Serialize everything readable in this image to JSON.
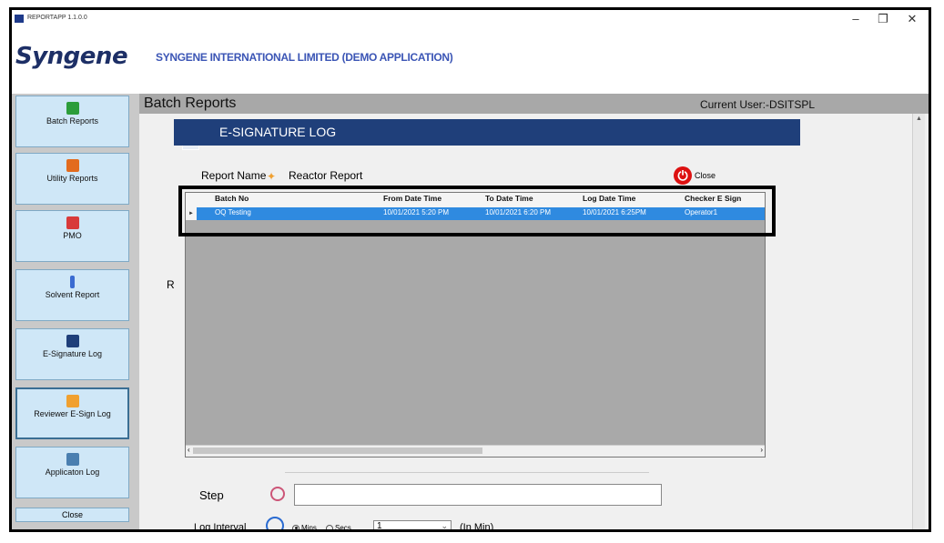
{
  "window": {
    "title": "REPORTAPP 1.1.0.0",
    "minimize": "–",
    "maximize": "❐",
    "close": "✕"
  },
  "header": {
    "logo": "Syngene",
    "company": "SYNGENE INTERNATIONAL LIMITED (DEMO APPLICATION)"
  },
  "sidebar": {
    "items": [
      {
        "label": "Batch Reports",
        "icon": "batch-icon",
        "color": "#2c9d3a"
      },
      {
        "label": "Utility Reports",
        "icon": "utility-icon",
        "color": "#e36b1e"
      },
      {
        "label": "PMO",
        "icon": "pmo-icon",
        "color": "#d83a3a"
      },
      {
        "label": "Solvent Report",
        "icon": "solvent-icon",
        "color": "#3a6bd1"
      },
      {
        "label": "E-Signature Log",
        "icon": "esign-icon",
        "color": "#1f3f7a"
      },
      {
        "label": "Reviewer E-Sign Log",
        "icon": "reviewer-icon",
        "color": "#f0a030"
      },
      {
        "label": "Applicaton Log",
        "icon": "applog-icon",
        "color": "#4a7fb0"
      }
    ],
    "close_label": "Close"
  },
  "main": {
    "title": "Batch Reports",
    "current_user": "Current User:-DSITSPL",
    "r_label": "R"
  },
  "dialog": {
    "title": "E-SIGNATURE LOG",
    "report_name_label": "Report Name",
    "report_name_value": "Reactor Report",
    "close_label": "Close",
    "grid": {
      "columns": [
        "Batch No",
        "From Date Time",
        "To Date Time",
        "Log Date Time",
        "Checker E Sign"
      ],
      "rows": [
        [
          "OQ Testing",
          "10/01/2021 5:20 PM",
          "10/01/2021 6:20 PM",
          "10/01/2021 6:25PM",
          "Operator1"
        ]
      ]
    }
  },
  "step": {
    "label": "Step",
    "value": ""
  },
  "log_interval": {
    "label": "Log Interval",
    "opt1": "Mins",
    "opt2": "Secs",
    "value": "1",
    "unit": "(In Min)"
  },
  "colors": {
    "accent": "#1f3f7a",
    "selection": "#2f8ae0",
    "nav_bg": "#cfe7f7"
  }
}
